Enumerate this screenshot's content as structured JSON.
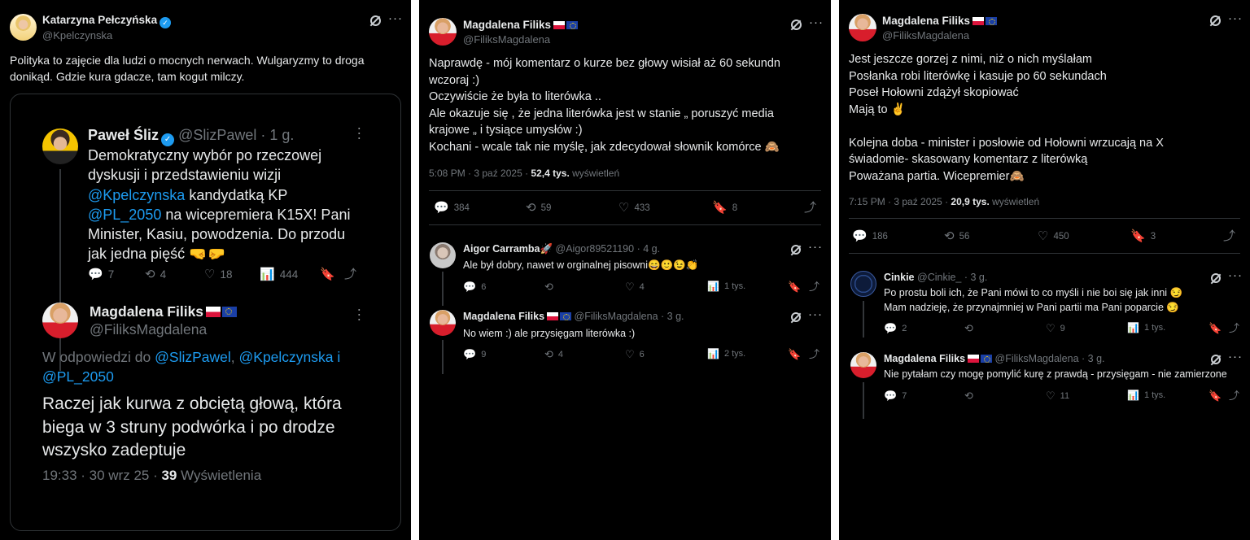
{
  "panel1": {
    "author": {
      "name": "Katarzyna Pełczyńska",
      "handle": "@Kpelczynska"
    },
    "text_lines": [
      "Polityka to zajęcie dla ludzi o mocnych nerwach. Wulgaryzmy to droga",
      "donikąd. Gdzie kura gdacze, tam kogut milczy."
    ],
    "quoted": {
      "first": {
        "name": "Paweł Śliz",
        "handle": "@SlizPawel",
        "time": "· 1 g.",
        "lines": [
          "Demokratyczny wybór po rzeczowej",
          "dyskusji i przedstawieniu wizji"
        ],
        "line3_link": "@Kpelczynska",
        "line3_rest": " kandydatką KP",
        "line4_link": "@PL_2050",
        "line4_rest": " na wicepremiera K15X! Pani",
        "lines_end": [
          "Minister, Kasiu, powodzenia. Do przodu",
          "jak jedna pięść 🤜🤛"
        ],
        "replies": "7",
        "reposts": "4",
        "likes": "18",
        "views": "444"
      },
      "second": {
        "name": "Magdalena Filiks",
        "handle": "@FiliksMagdalena",
        "reply_to_prefix": "W odpowiedzi do ",
        "reply_to_1": "@SlizPawel",
        "reply_to_2": "@Kpelczynska",
        "reply_to_i": " i",
        "reply_to_3": "@PL_2050",
        "lines": [
          "Raczej jak kurwa z obciętą głową, która",
          "biega w 3 struny podwórka i po drodze",
          "wszysko zadeptuje"
        ],
        "meta_time": "19:33 · 30 wrz 25 · ",
        "meta_views": "39",
        "meta_views_label": " Wyświetlenia"
      }
    }
  },
  "panel2": {
    "author": {
      "name": "Magdalena Filiks",
      "handle": "@FiliksMagdalena"
    },
    "text_lines": [
      "Naprawdę - mój komentarz o kurze bez głowy wisiał aż 60 sekundn",
      "wczoraj :)",
      "Oczywiście że była to literówka ..",
      "Ale okazuje  się , że jedna literówka jest w stanie „ poruszyć media",
      "krajowe „ i tysiące umysłów :)",
      "Kochani - wcale tak nie myślę, jak zdecydował słownik komórce 🙈"
    ],
    "meta": {
      "time": "5:08 PM · 3 paź 2025 · ",
      "views": "52,4 tys.",
      "views_label": " wyświetleń"
    },
    "stats": {
      "replies": "384",
      "reposts": "59",
      "likes": "433",
      "bookmarks": "8"
    },
    "replies": [
      {
        "name": "Aigor Carramba🚀",
        "handle": "@Aigor89521190",
        "time": "· 4 g.",
        "text": "Ale był dobry, nawet w orginalnej pisowni😄🙂😉👏",
        "replies": "6",
        "reposts": "",
        "likes": "4",
        "views": "1 tys."
      },
      {
        "name": "Magdalena Filiks",
        "handle": "@FiliksMagdalena",
        "time": "· 3 g.",
        "text": "No wiem :) ale przysięgam literówka :)",
        "replies": "9",
        "reposts": "4",
        "likes": "6",
        "views": "2 tys."
      }
    ]
  },
  "panel3": {
    "author": {
      "name": "Magdalena Filiks",
      "handle": "@FiliksMagdalena"
    },
    "text_lines": [
      "Jest jeszcze gorzej z nimi, niż o nich myślałam",
      "Posłanka robi literówkę i kasuje po 60 sekundach",
      "Poseł Hołowni zdążył skopiować",
      "Mają to ✌️",
      "",
      "Kolejna doba - minister i posłowie  od Hołowni wrzucają na X",
      "świadomie- skasowany komentarz z literówką",
      "Poważana partia. Wicepremier🙈"
    ],
    "meta": {
      "time": "7:15 PM · 3 paź 2025 · ",
      "views": "20,9 tys.",
      "views_label": " wyświetleń"
    },
    "stats": {
      "replies": "186",
      "reposts": "56",
      "likes": "450",
      "bookmarks": "3"
    },
    "replies": [
      {
        "name": "Cinkie",
        "handle": "@Cinkie_",
        "time": "· 3 g.",
        "lines": [
          "Po prostu boli ich, że Pani mówi to co myśli i nie boi się jak inni 😏",
          "Mam nadzieję, że przynajmniej w Pani partii ma Pani poparcie 😏"
        ],
        "replies": "2",
        "reposts": "",
        "likes": "9",
        "views": "1 tys."
      },
      {
        "name": "Magdalena Filiks",
        "handle": "@FiliksMagdalena",
        "time": "· 3 g.",
        "lines": [
          "Nie pytałam czy mogę pomylić kurę z prawdą - przysięgam - nie zamierzone"
        ],
        "replies": "7",
        "reposts": "",
        "likes": "11",
        "views": "1 tys."
      }
    ]
  },
  "icons": {
    "reply": "💬",
    "repost": "⟲",
    "like": "♡",
    "views": "📊",
    "bookmark": "🔖",
    "share": "⤴"
  },
  "colors": {
    "background": "#000000",
    "text": "#e7e9ea",
    "muted": "#71767b",
    "link": "#1d9bf0",
    "verified": "#1d9bf0"
  }
}
